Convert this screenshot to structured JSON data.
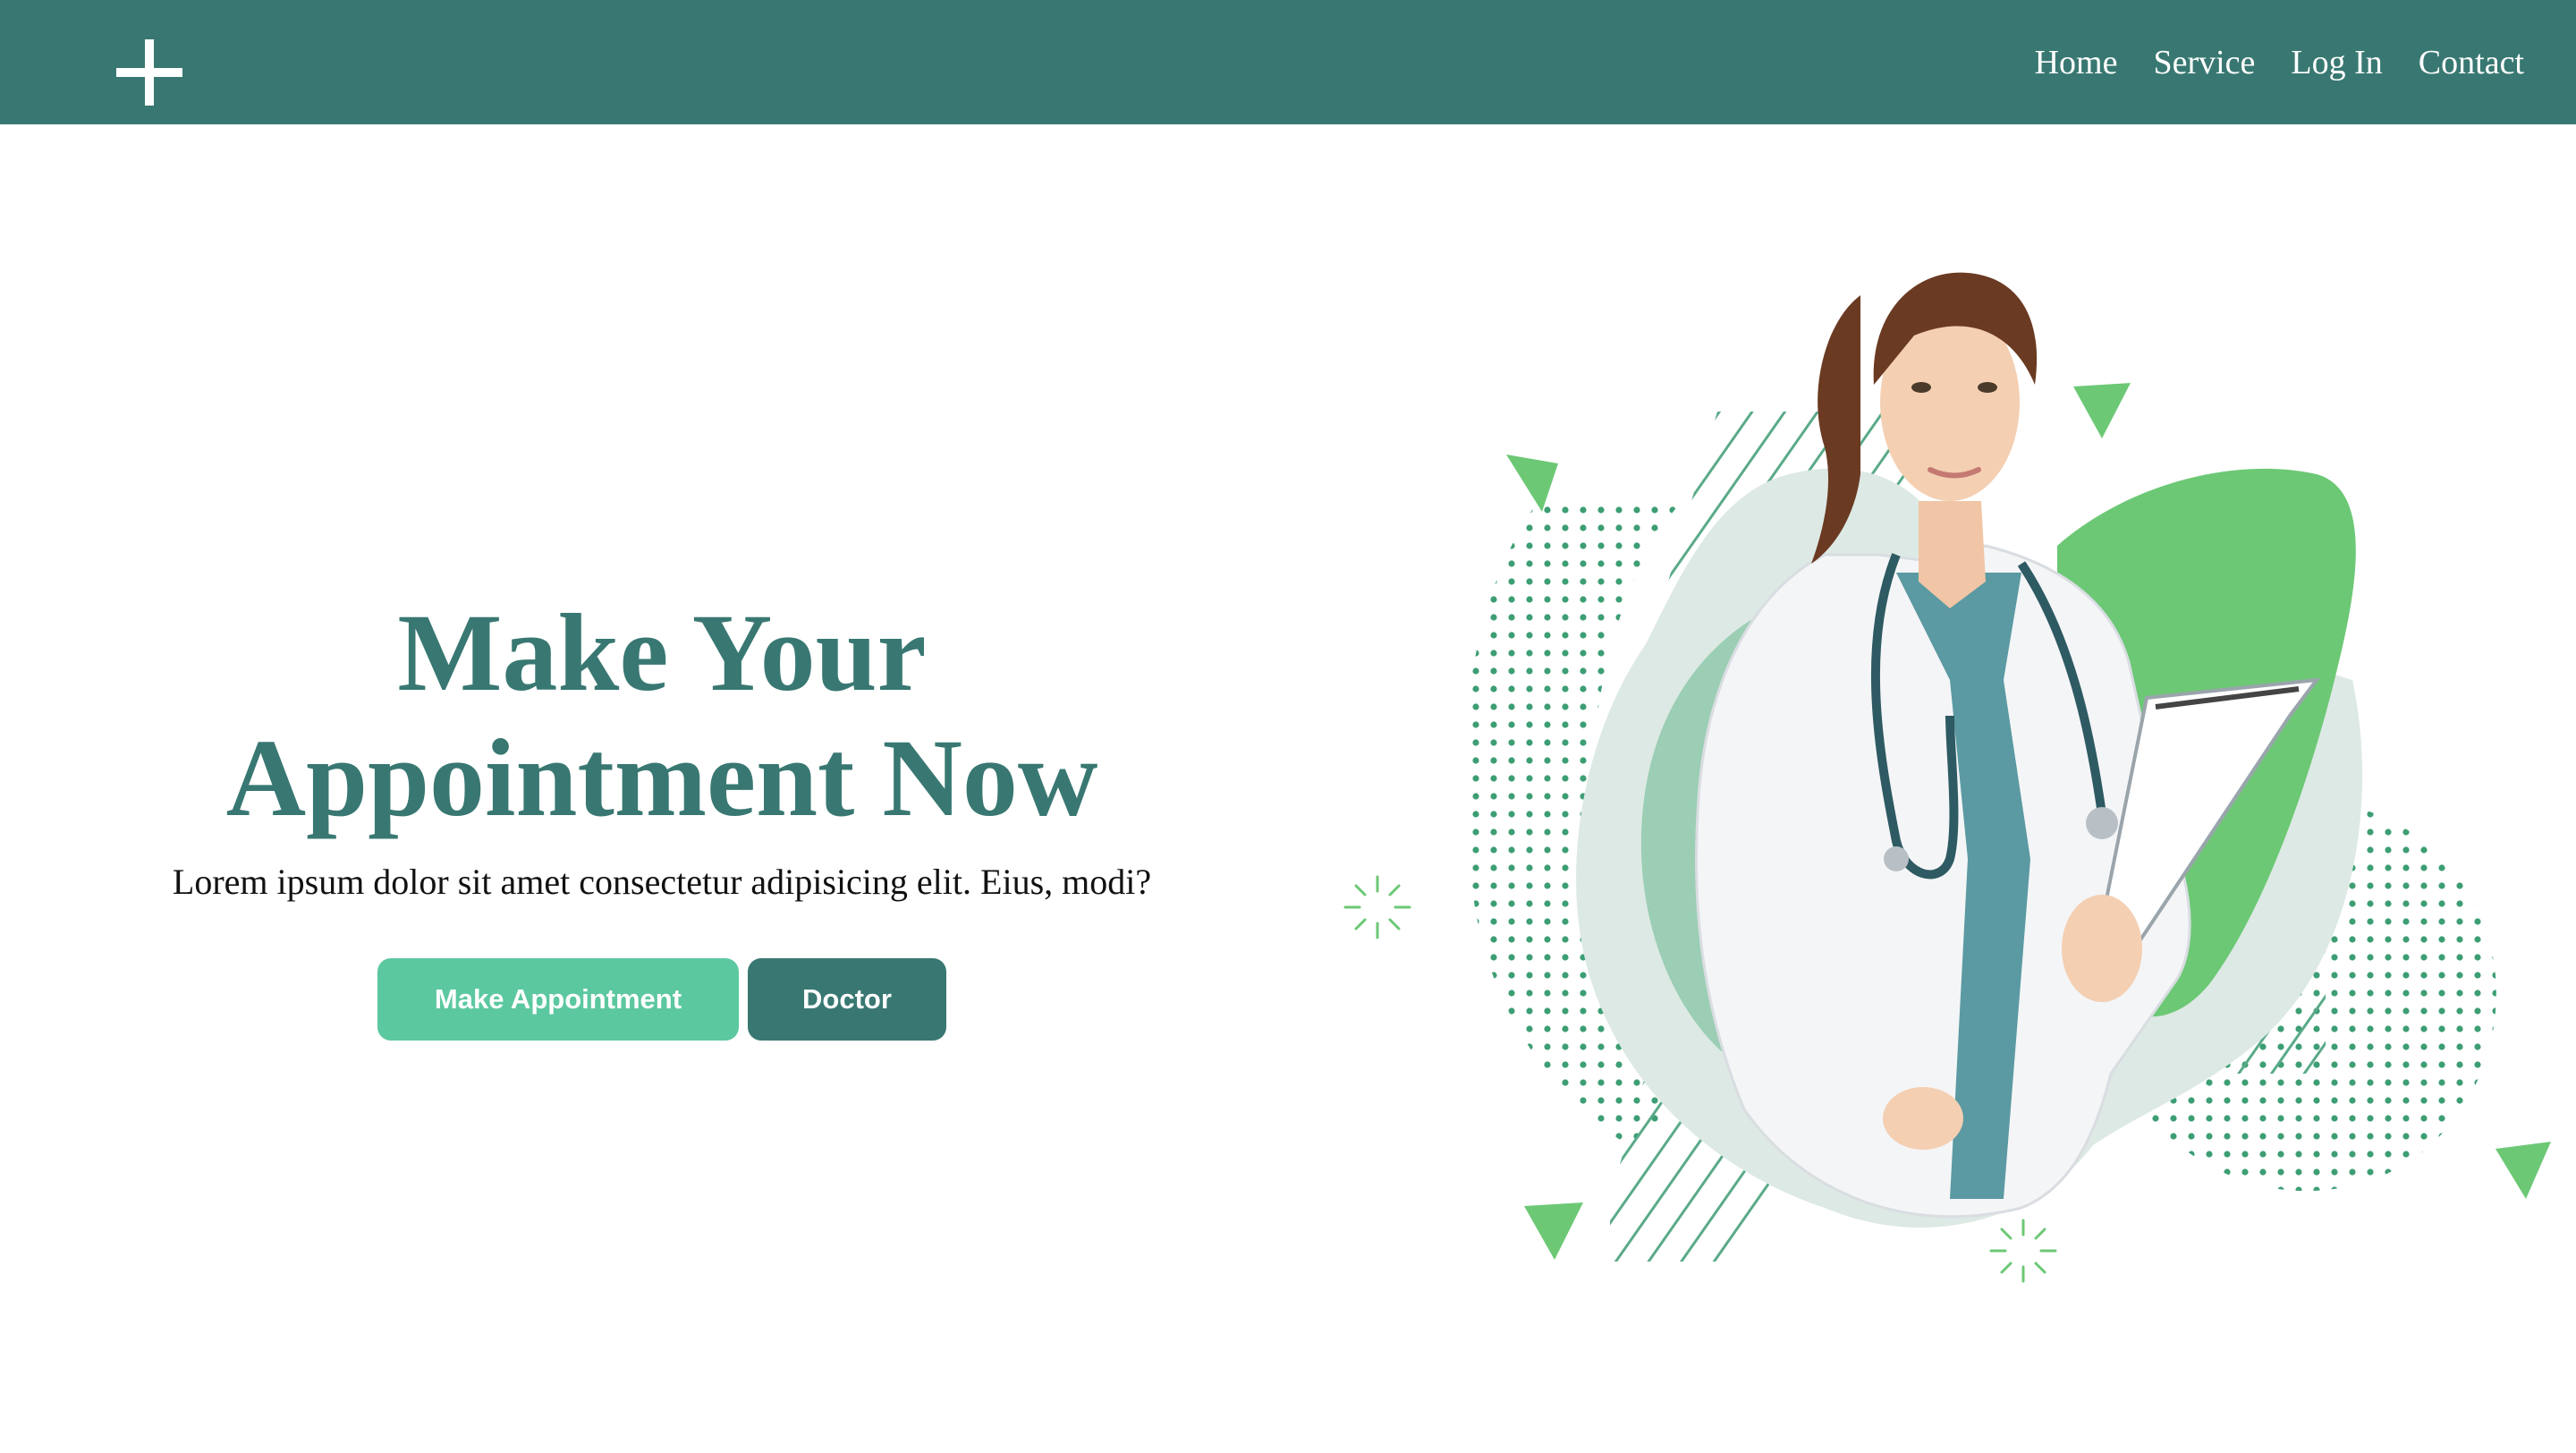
{
  "brand": {
    "logo_icon": "plus-icon"
  },
  "nav": {
    "items": [
      {
        "label": "Home"
      },
      {
        "label": "Service"
      },
      {
        "label": "Log In"
      },
      {
        "label": "Contact"
      }
    ]
  },
  "hero": {
    "title_line1": "Make Your",
    "title_line2": "Appointment Now",
    "subtitle": "Lorem ipsum dolor sit amet consectetur adipisicing elit. Eius, modi?",
    "primary_button": "Make Appointment",
    "secondary_button": "Doctor",
    "illustration": "doctor-illustration"
  },
  "colors": {
    "nav_background": "#397872",
    "title": "#397872",
    "primary_button": "#5cc8a0",
    "secondary_button": "#397872",
    "accent_green": "#6cc875",
    "dots": "#3d9e74"
  }
}
